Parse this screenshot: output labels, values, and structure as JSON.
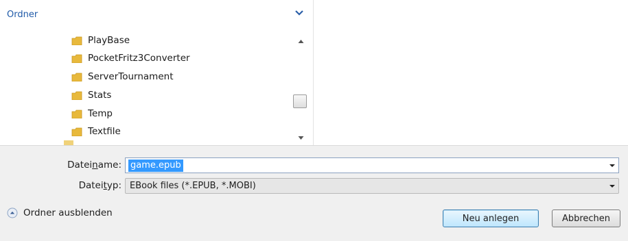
{
  "nav": {
    "title": "Ordner",
    "folders": [
      {
        "label": "PlayBase"
      },
      {
        "label": "PocketFritz3Converter"
      },
      {
        "label": "ServerTournament"
      },
      {
        "label": "Stats"
      },
      {
        "label": "Temp"
      },
      {
        "label": "Textfile"
      }
    ]
  },
  "form": {
    "filename_label_pre": "Datei",
    "filename_label_u": "n",
    "filename_label_post": "ame:",
    "filename_value": "game.epub",
    "filetype_label_pre": "Datei",
    "filetype_label_u": "t",
    "filetype_label_post": "yp:",
    "filetype_value": "EBook files (*.EPUB, *.MOBI)"
  },
  "footer": {
    "hide_folders_label": "Ordner ausblenden",
    "create_button": "Neu anlegen",
    "cancel_button": "Abbrechen"
  },
  "colors": {
    "accent_blue": "#1f5aa8",
    "selection": "#3399ff",
    "folder_yellow": "#e8b93c"
  }
}
